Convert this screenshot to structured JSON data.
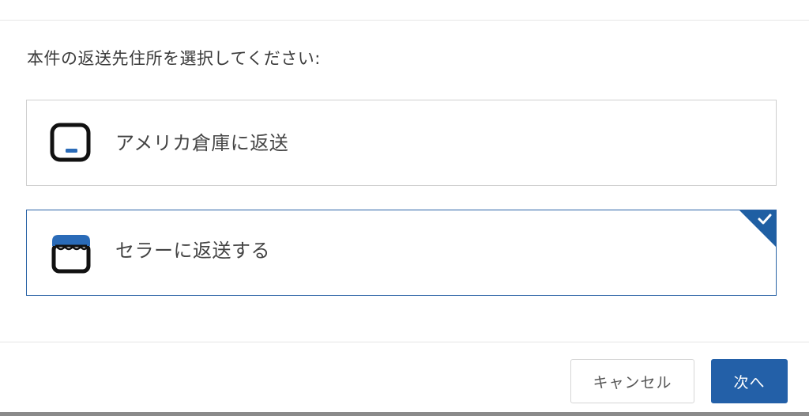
{
  "dialog": {
    "prompt": "本件の返送先住所を選択してください:",
    "options": [
      {
        "label": "アメリカ倉庫に返送",
        "icon": "warehouse-box-icon",
        "selected": false
      },
      {
        "label": "セラーに返送する",
        "icon": "store-icon",
        "selected": true
      }
    ],
    "buttons": {
      "cancel_label": "キャンセル",
      "next_label": "次へ"
    }
  },
  "colors": {
    "accent": "#2360a8",
    "selected_border": "#2a63a6",
    "text": "#333333"
  }
}
